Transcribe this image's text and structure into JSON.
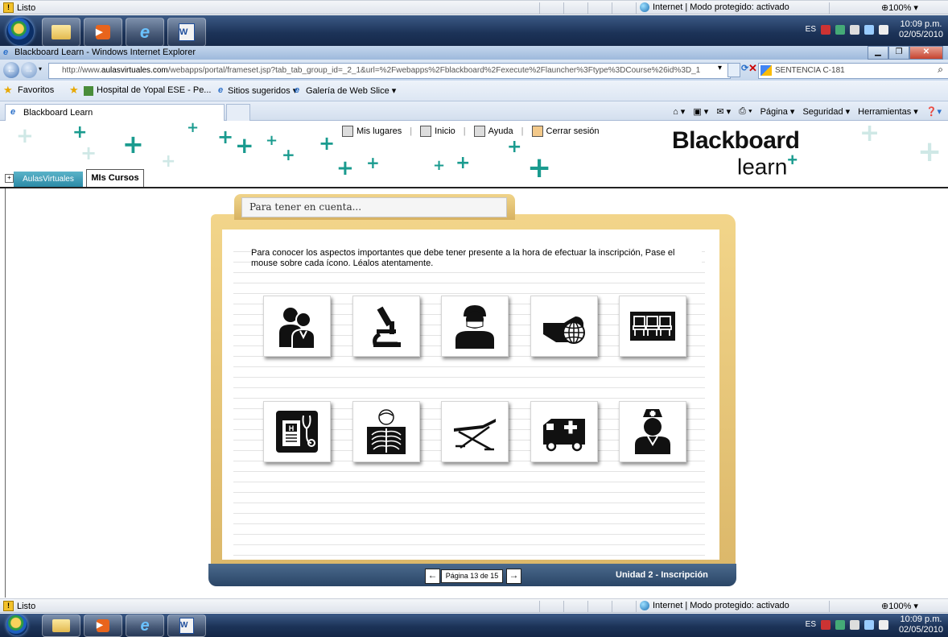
{
  "status": {
    "left": "Listo",
    "security": "Internet | Modo protegido: activado",
    "zoom": "100%"
  },
  "taskbar": {
    "lang": "ES",
    "time": "10:09 p.m.",
    "date": "02/05/2010"
  },
  "window": {
    "title": "Blackboard Learn - Windows Internet Explorer"
  },
  "address": {
    "url_prefix": "http://www.",
    "url_domain": "aulasvirtuales.com",
    "url_rest": "/webapps/portal/frameset.jsp?tab_tab_group_id=_2_1&url=%2Fwebapps%2Fblackboard%2Fexecute%2Flauncher%3Ftype%3DCourse%26id%3D_1",
    "search": "SENTENCIA C-181"
  },
  "favorites": {
    "label": "Favoritos",
    "items": [
      "Hospital de Yopal ESE - Pe...",
      "Sitios sugeridos ▾",
      "Galería de Web Slice ▾"
    ]
  },
  "tabs": {
    "current": "Blackboard Learn"
  },
  "commands": {
    "page": "Página ▾",
    "security": "Seguridad ▾",
    "tools": "Herramientas ▾"
  },
  "bb": {
    "logo_top": "Blackboard",
    "logo_bottom": "learn",
    "nav": [
      "Mis lugares",
      "Inicio",
      "Ayuda",
      "Cerrar sesión"
    ],
    "tab1": "AulasVirtuales",
    "tab2": "MIs Cursos"
  },
  "content": {
    "folder_title": "Para tener en cuenta...",
    "instructions": "Para conocer los aspectos importantes que debe tener presente a la hora de efectuar la inscripción, Pase el mouse sobre cada ícono. Léalos atentamente.",
    "icons_row1": [
      "doctors-icon",
      "microscope-icon",
      "surgeon-icon",
      "globe-hand-icon",
      "waiting-chairs-icon"
    ],
    "icons_row2": [
      "medical-chart-icon",
      "xray-icon",
      "stretcher-icon",
      "ambulance-icon",
      "nurse-icon"
    ]
  },
  "footer": {
    "page": "Página 13 de 15",
    "unit": "Unidad 2 - Inscripción"
  }
}
